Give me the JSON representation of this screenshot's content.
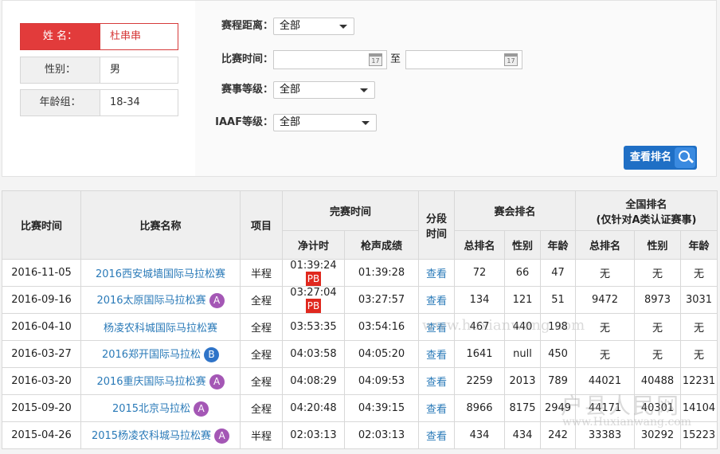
{
  "profile": {
    "name_label": "姓 名：",
    "name_value": "杜串串",
    "gender_label": "性别：",
    "gender_value": "男",
    "age_label": "年龄组：",
    "age_value": "18-34"
  },
  "filters": {
    "distance_label": "赛程距离：",
    "distance_value": "全部",
    "time_label": "比赛时间：",
    "to_label": "至",
    "level_label": "赛事等级：",
    "level_value": "全部",
    "iaaf_label": "IAAF等级：",
    "iaaf_value": "全部",
    "search_button": "查看排名"
  },
  "table": {
    "headers": {
      "date": "比赛时间",
      "name": "比赛名称",
      "item": "项目",
      "finish": "完赛时间",
      "net": "净计时",
      "gun": "枪声成绩",
      "split_1": "分段",
      "split_2": "时间",
      "meet_rank": "赛会排名",
      "total": "总排名",
      "gender": "性别",
      "age": "年龄",
      "national_1": "全国排名",
      "national_2": "(仅针对A类认证赛事)",
      "n_total": "总排名",
      "n_gender": "性别",
      "n_age": "年龄"
    },
    "rows": [
      {
        "date": "2016-11-05",
        "name": "2016西安城墙国际马拉松赛",
        "badge": "",
        "item": "半程",
        "net": "01:39:24",
        "pb": "PB",
        "gun": "01:39:28",
        "view": "查看",
        "total": "72",
        "gender": "66",
        "age": "47",
        "n_total": "无",
        "n_gender": "无",
        "n_age": "无"
      },
      {
        "date": "2016-09-16",
        "name": "2016太原国际马拉松赛",
        "badge": "A",
        "item": "全程",
        "net": "03:27:04",
        "pb": "PB",
        "gun": "03:27:57",
        "view": "查看",
        "total": "134",
        "gender": "121",
        "age": "51",
        "n_total": "9472",
        "n_gender": "8973",
        "n_age": "3031"
      },
      {
        "date": "2016-04-10",
        "name": "杨凌农科城国际马拉松赛",
        "badge": "",
        "item": "全程",
        "net": "03:53:35",
        "pb": "",
        "gun": "03:54:16",
        "view": "查看",
        "total": "467",
        "gender": "440",
        "age": "198",
        "n_total": "无",
        "n_gender": "无",
        "n_age": "无"
      },
      {
        "date": "2016-03-27",
        "name": "2016郑开国际马拉松",
        "badge": "B",
        "item": "全程",
        "net": "04:03:58",
        "pb": "",
        "gun": "04:05:20",
        "view": "查看",
        "total": "1641",
        "gender": "null",
        "age": "450",
        "n_total": "无",
        "n_gender": "无",
        "n_age": "无"
      },
      {
        "date": "2016-03-20",
        "name": "2016重庆国际马拉松赛",
        "badge": "A",
        "item": "全程",
        "net": "04:08:29",
        "pb": "",
        "gun": "04:09:53",
        "view": "查看",
        "total": "2259",
        "gender": "2013",
        "age": "789",
        "n_total": "44021",
        "n_gender": "40488",
        "n_age": "12231"
      },
      {
        "date": "2015-09-20",
        "name": "2015北京马拉松",
        "badge": "A",
        "item": "全程",
        "net": "04:20:48",
        "pb": "",
        "gun": "04:39:15",
        "view": "查看",
        "total": "8966",
        "gender": "8175",
        "age": "2949",
        "n_total": "44171",
        "n_gender": "40301",
        "n_age": "14104"
      },
      {
        "date": "2015-04-26",
        "name": "2015杨凌农科城马拉松赛",
        "badge": "A",
        "item": "半程",
        "net": "02:03:13",
        "pb": "",
        "gun": "02:03:13",
        "view": "查看",
        "total": "434",
        "gender": "434",
        "age": "242",
        "n_total": "33383",
        "n_gender": "30292",
        "n_age": "15223"
      }
    ]
  },
  "colors": {
    "badge_A": "#a457b5",
    "badge_B": "#2f74c8",
    "pb": "#e0281e",
    "link": "#2a7ab8",
    "active": "#e23b3b"
  },
  "watermarks": {
    "mid": "www.huxianwang.com",
    "logo": "户县人民网",
    "url": "www.Huxianwang.com"
  }
}
